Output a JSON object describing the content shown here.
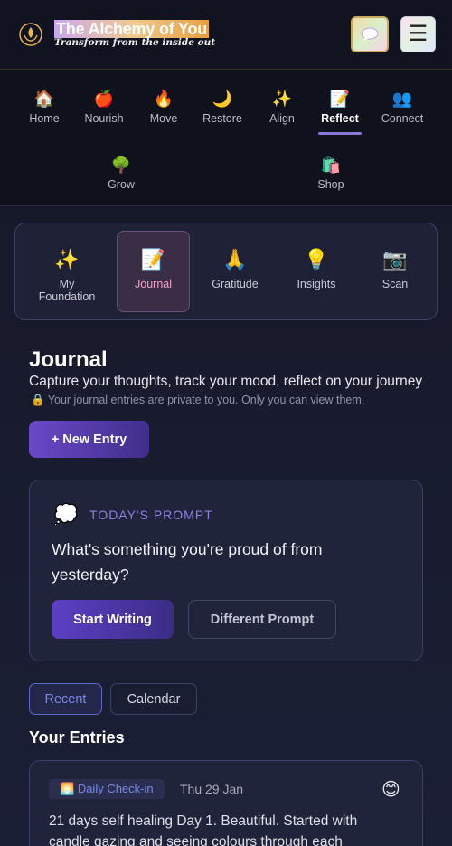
{
  "header": {
    "title": "The Alchemy of You",
    "tagline": "Transform from the inside out",
    "logo_icon": "lotus-flame-icon",
    "chat_icon": "speech-bubble-icon",
    "menu_icon": "hamburger-icon",
    "menu_glyph": "☰"
  },
  "nav": {
    "items": [
      {
        "label": "Home",
        "icon": "🏠"
      },
      {
        "label": "Nourish",
        "icon": "🍎"
      },
      {
        "label": "Move",
        "icon": "🔥"
      },
      {
        "label": "Restore",
        "icon": "🌙"
      },
      {
        "label": "Align",
        "icon": "✨"
      },
      {
        "label": "Reflect",
        "icon": "📝"
      },
      {
        "label": "Connect",
        "icon": "👥"
      },
      {
        "label": "Grow",
        "icon": "🌳"
      },
      {
        "label": "Shop",
        "icon": "🛍️"
      }
    ],
    "active": "Reflect"
  },
  "subnav": {
    "items": [
      {
        "label": "My Foundation",
        "icon": "✨"
      },
      {
        "label": "Journal",
        "icon": "📝"
      },
      {
        "label": "Gratitude",
        "icon": "🙏"
      },
      {
        "label": "Insights",
        "icon": "💡"
      },
      {
        "label": "Scan",
        "icon": "📷"
      }
    ],
    "active": "Journal"
  },
  "page": {
    "title": "Journal",
    "subtitle": "Capture your thoughts, track your mood, reflect on your journey",
    "privacy_icon": "🔒",
    "privacy_note": "Your journal entries are private to you. Only you can view them.",
    "new_entry_label": "+ New Entry"
  },
  "prompt": {
    "icon": "💭",
    "label": "TODAY'S PROMPT",
    "text": "What's something you're proud of from yesterday?",
    "start_label": "Start Writing",
    "different_label": "Different Prompt"
  },
  "tabs": {
    "recent": "Recent",
    "calendar": "Calendar",
    "active": "Recent"
  },
  "entries": {
    "title": "Your Entries",
    "items": [
      {
        "badge_icon": "🌅",
        "badge": "Daily Check-in",
        "date": "Thu 29 Jan",
        "mood": "😊",
        "text": "21 days self healing Day 1. Beautiful. Started with candle gazing and seeing colours through each"
      }
    ]
  },
  "colors": {
    "accent": "#8a78d8",
    "active_subnav_text": "#f2a2c8",
    "prompt_label": "#8c7fe0",
    "background": "#171a2b"
  }
}
